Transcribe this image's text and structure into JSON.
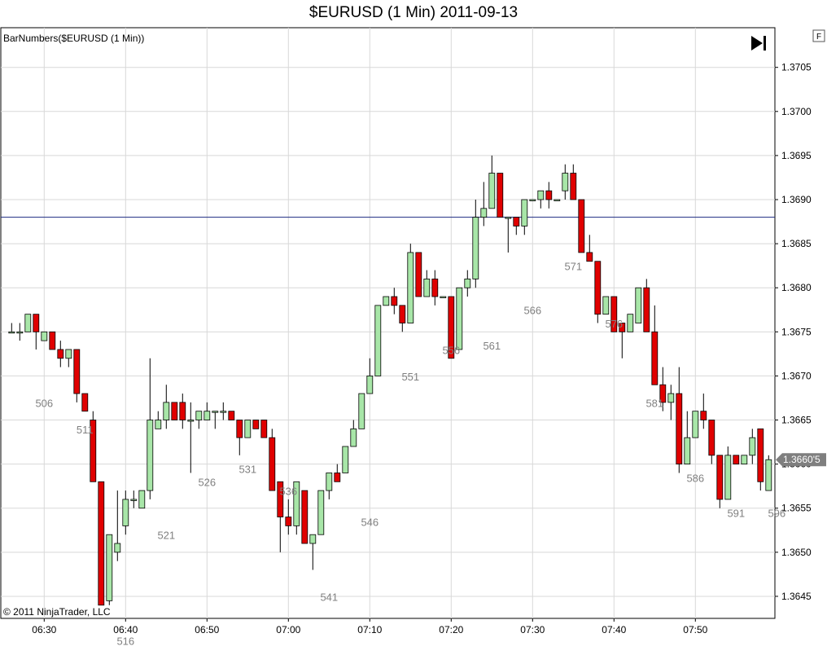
{
  "title": "$EURUSD (1 Min)  2011-09-13",
  "indicator_label": "BarNumbers($EURUSD (1 Min))",
  "copyright": "© 2011 NinjaTrader, LLC",
  "panel_button": "F",
  "last_price_label": "1.3660'5",
  "colors": {
    "up": "#a8e6a8",
    "down": "#e00000",
    "wick": "#000000",
    "grid": "#d8d8d8",
    "hline": "#1c2a80",
    "price_tag": "#7f7f7f"
  },
  "icons": {
    "go_to_end": "skip-to-end-icon"
  },
  "chart_data": {
    "type": "candlestick",
    "title": "$EURUSD (1 Min)  2011-09-13",
    "xlabel": "",
    "ylabel": "",
    "ylim": [
      1.36425,
      1.37095
    ],
    "y_ticks": [
      "1.3645",
      "1.3650",
      "1.3655",
      "1.3660",
      "1.3665",
      "1.3670",
      "1.3675",
      "1.3680",
      "1.3685",
      "1.3690",
      "1.3695",
      "1.3700",
      "1.3705"
    ],
    "x_ticks": [
      "06:30",
      "06:40",
      "06:50",
      "07:00",
      "07:10",
      "07:20",
      "07:30",
      "07:40",
      "07:50"
    ],
    "grid": true,
    "first_bar_time": "06:26",
    "first_bar_number": 502,
    "horizontal_line": 1.3688,
    "last_price": 1.36605,
    "bar_number_labels": [
      {
        "bar": 506,
        "text": "506",
        "y": 1.36665
      },
      {
        "bar": 511,
        "text": "511",
        "y": 1.36635
      },
      {
        "bar": 516,
        "text": "516",
        "y": 1.36395
      },
      {
        "bar": 521,
        "text": "521",
        "y": 1.36515
      },
      {
        "bar": 526,
        "text": "526",
        "y": 1.36575
      },
      {
        "bar": 531,
        "text": "531",
        "y": 1.3659
      },
      {
        "bar": 536,
        "text": "536",
        "y": 1.36565
      },
      {
        "bar": 541,
        "text": "541",
        "y": 1.36445
      },
      {
        "bar": 546,
        "text": "546",
        "y": 1.3653
      },
      {
        "bar": 551,
        "text": "551",
        "y": 1.36695
      },
      {
        "bar": 556,
        "text": "556",
        "y": 1.36725
      },
      {
        "bar": 561,
        "text": "561",
        "y": 1.3673
      },
      {
        "bar": 566,
        "text": "566",
        "y": 1.3677
      },
      {
        "bar": 571,
        "text": "571",
        "y": 1.3682
      },
      {
        "bar": 576,
        "text": "576",
        "y": 1.36755
      },
      {
        "bar": 581,
        "text": "581",
        "y": 1.36665
      },
      {
        "bar": 586,
        "text": "586",
        "y": 1.3658
      },
      {
        "bar": 591,
        "text": "591",
        "y": 1.3654
      },
      {
        "bar": 596,
        "text": "596",
        "y": 1.3654
      }
    ],
    "ohlc": [
      [
        1.3675,
        1.3676,
        1.3675,
        1.3675
      ],
      [
        1.3675,
        1.3676,
        1.3674,
        1.3675
      ],
      [
        1.3675,
        1.3677,
        1.3675,
        1.3677
      ],
      [
        1.3677,
        1.3677,
        1.3673,
        1.3675
      ],
      [
        1.3674,
        1.3675,
        1.3674,
        1.3675
      ],
      [
        1.3675,
        1.3675,
        1.3673,
        1.3673
      ],
      [
        1.3673,
        1.3674,
        1.3671,
        1.3672
      ],
      [
        1.3672,
        1.3673,
        1.3671,
        1.3673
      ],
      [
        1.3673,
        1.3673,
        1.3667,
        1.3668
      ],
      [
        1.3668,
        1.3668,
        1.3666,
        1.3666
      ],
      [
        1.3665,
        1.3666,
        1.3658,
        1.3658
      ],
      [
        1.3658,
        1.3658,
        1.3644,
        1.3644
      ],
      [
        1.36445,
        1.3652,
        1.3644,
        1.3652
      ],
      [
        1.365,
        1.3657,
        1.3649,
        1.3651
      ],
      [
        1.3653,
        1.3657,
        1.3652,
        1.3656
      ],
      [
        1.3656,
        1.3657,
        1.3655,
        1.3656
      ],
      [
        1.3655,
        1.3657,
        1.3655,
        1.3657
      ],
      [
        1.3657,
        1.3672,
        1.3656,
        1.3665
      ],
      [
        1.3664,
        1.3666,
        1.3664,
        1.3665
      ],
      [
        1.3665,
        1.3669,
        1.3664,
        1.3667
      ],
      [
        1.3667,
        1.3667,
        1.3665,
        1.3665
      ],
      [
        1.3667,
        1.3668,
        1.3664,
        1.3665
      ],
      [
        1.3665,
        1.3667,
        1.3659,
        1.3665
      ],
      [
        1.3665,
        1.3666,
        1.3664,
        1.3666
      ],
      [
        1.3665,
        1.3667,
        1.3665,
        1.3666
      ],
      [
        1.3666,
        1.3666,
        1.3664,
        1.3666
      ],
      [
        1.3666,
        1.3667,
        1.3665,
        1.3666
      ],
      [
        1.3666,
        1.3666,
        1.3665,
        1.3665
      ],
      [
        1.3665,
        1.3665,
        1.3661,
        1.3663
      ],
      [
        1.3663,
        1.3665,
        1.3663,
        1.3665
      ],
      [
        1.3665,
        1.3665,
        1.3664,
        1.3664
      ],
      [
        1.3665,
        1.3665,
        1.3663,
        1.3663
      ],
      [
        1.3663,
        1.3664,
        1.3657,
        1.3657
      ],
      [
        1.3658,
        1.3658,
        1.365,
        1.3654
      ],
      [
        1.3654,
        1.3656,
        1.3652,
        1.3653
      ],
      [
        1.3653,
        1.3658,
        1.3652,
        1.3658
      ],
      [
        1.3657,
        1.3657,
        1.3651,
        1.3651
      ],
      [
        1.3651,
        1.3652,
        1.3648,
        1.3652
      ],
      [
        1.3652,
        1.3657,
        1.3652,
        1.3657
      ],
      [
        1.3657,
        1.3659,
        1.3656,
        1.3659
      ],
      [
        1.3659,
        1.366,
        1.3658,
        1.3658
      ],
      [
        1.3659,
        1.3662,
        1.3659,
        1.3662
      ],
      [
        1.3662,
        1.3665,
        1.3662,
        1.3664
      ],
      [
        1.3664,
        1.3668,
        1.3664,
        1.3668
      ],
      [
        1.3668,
        1.3672,
        1.3668,
        1.367
      ],
      [
        1.367,
        1.3678,
        1.367,
        1.3678
      ],
      [
        1.3678,
        1.3679,
        1.3678,
        1.3679
      ],
      [
        1.3679,
        1.368,
        1.3677,
        1.3678
      ],
      [
        1.3678,
        1.3678,
        1.3675,
        1.3676
      ],
      [
        1.3676,
        1.3685,
        1.3676,
        1.3684
      ],
      [
        1.3684,
        1.3684,
        1.3679,
        1.3679
      ],
      [
        1.3679,
        1.3682,
        1.3679,
        1.3681
      ],
      [
        1.3681,
        1.3682,
        1.3678,
        1.3679
      ],
      [
        1.3679,
        1.3679,
        1.3679,
        1.3679
      ],
      [
        1.3679,
        1.3679,
        1.3672,
        1.3672
      ],
      [
        1.3673,
        1.368,
        1.3673,
        1.368
      ],
      [
        1.368,
        1.3682,
        1.3679,
        1.3681
      ],
      [
        1.3681,
        1.369,
        1.368,
        1.3688
      ],
      [
        1.3688,
        1.3692,
        1.3687,
        1.3689
      ],
      [
        1.3689,
        1.3695,
        1.3689,
        1.3693
      ],
      [
        1.3693,
        1.3693,
        1.3688,
        1.3688
      ],
      [
        1.3688,
        1.3688,
        1.3684,
        1.3688
      ],
      [
        1.3688,
        1.3688,
        1.3686,
        1.3687
      ],
      [
        1.3687,
        1.369,
        1.3686,
        1.369
      ],
      [
        1.369,
        1.369,
        1.369,
        1.369
      ],
      [
        1.369,
        1.3691,
        1.3689,
        1.3691
      ],
      [
        1.3691,
        1.3692,
        1.3689,
        1.369
      ],
      [
        1.369,
        1.369,
        1.369,
        1.369
      ],
      [
        1.3691,
        1.3694,
        1.369,
        1.3693
      ],
      [
        1.3693,
        1.3694,
        1.369,
        1.369
      ],
      [
        1.369,
        1.369,
        1.3684,
        1.3684
      ],
      [
        1.3684,
        1.3686,
        1.3683,
        1.3683
      ],
      [
        1.3683,
        1.3683,
        1.3676,
        1.3677
      ],
      [
        1.3677,
        1.3679,
        1.3677,
        1.3679
      ],
      [
        1.3679,
        1.3679,
        1.3675,
        1.3675
      ],
      [
        1.3676,
        1.3676,
        1.3672,
        1.3675
      ],
      [
        1.3675,
        1.3677,
        1.3675,
        1.3677
      ],
      [
        1.3676,
        1.368,
        1.3676,
        1.368
      ],
      [
        1.368,
        1.3681,
        1.3675,
        1.3675
      ],
      [
        1.3675,
        1.3678,
        1.3669,
        1.3669
      ],
      [
        1.3669,
        1.3671,
        1.3666,
        1.3667
      ],
      [
        1.3667,
        1.3669,
        1.3665,
        1.3668
      ],
      [
        1.3668,
        1.3671,
        1.3659,
        1.366
      ],
      [
        1.366,
        1.3666,
        1.366,
        1.3663
      ],
      [
        1.3663,
        1.3666,
        1.3663,
        1.3666
      ],
      [
        1.3666,
        1.3668,
        1.3664,
        1.3665
      ],
      [
        1.3665,
        1.3665,
        1.366,
        1.3661
      ],
      [
        1.3661,
        1.3661,
        1.3655,
        1.3656
      ],
      [
        1.3656,
        1.3662,
        1.3656,
        1.3661
      ],
      [
        1.3661,
        1.3661,
        1.366,
        1.366
      ],
      [
        1.366,
        1.3661,
        1.366,
        1.3661
      ],
      [
        1.3661,
        1.3664,
        1.366,
        1.3663
      ],
      [
        1.3664,
        1.3664,
        1.3657,
        1.3658
      ],
      [
        1.3657,
        1.3661,
        1.3657,
        1.36605
      ]
    ]
  }
}
